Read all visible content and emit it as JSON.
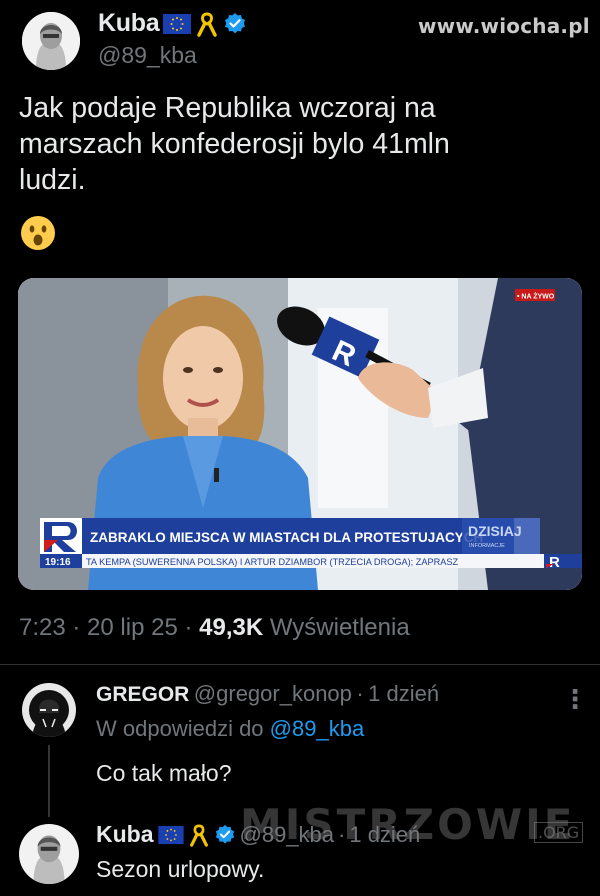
{
  "watermark_top": "www.wiocha.pl",
  "tweet": {
    "author_name": "Kuba",
    "author_handle": "@89_kba",
    "text_lines": [
      "Jak podaje Republika wczoraj na",
      "marszach konfederosji bylo 41mln",
      "ludzi."
    ],
    "emoji": "😮",
    "time": "7:23",
    "date": "20 lip 25",
    "views_count": "49,3K",
    "views_label": "Wyświetlenia",
    "icons": [
      "eu-flag-icon",
      "yellow-ribbon-icon",
      "verified-badge-icon"
    ]
  },
  "media": {
    "live_badge": "• NA ŻYWO",
    "headline": "ZABRAKLO MIEJSCA W MIASTACH DLA PROTESTUJACYCH",
    "time": "19:16",
    "ticker": "TA KEMPA (SUWERENNA POLSKA) I ARTUR DZIAMBOR (TRZECIA DROGA); ZAPRASZ",
    "program": "DZISIAJ",
    "program_sub": "INFORMACJE",
    "channel_letter": "R"
  },
  "replies": [
    {
      "name": "GREGOR",
      "handle": "@gregor_konop",
      "sep": "·",
      "age": "1 dzień",
      "reply_prefix": "W odpowiedzi do",
      "reply_to": "@89_kba",
      "text": "Co tak mało?"
    },
    {
      "name": "Kuba",
      "handle": "@89_kba",
      "sep": "·",
      "age": "1 dzień",
      "text": "Sezon urlopowy."
    }
  ],
  "watermark_bottom": "MISTRZOWIE",
  "watermark_bottom_org": ".ORG",
  "more_symbol": "⋮"
}
